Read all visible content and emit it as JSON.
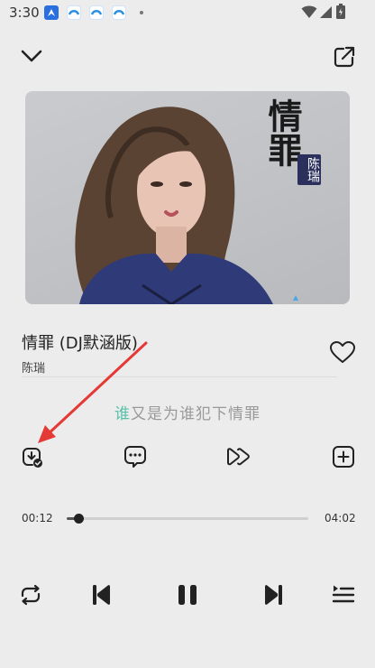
{
  "status_bar": {
    "time": "3:30"
  },
  "song": {
    "title": "情罪 (DJ默涵版)",
    "artist": "陈瑞",
    "cover_title": "情罪",
    "cover_artist": "陈瑞"
  },
  "lyrics": {
    "highlighted": "谁",
    "rest": "又是为谁犯下情罪"
  },
  "player": {
    "elapsed": "00:12",
    "duration": "04:02",
    "progress": 0.05
  },
  "colors": {
    "background": "#ececec",
    "lyric_highlight": "#58c0a8",
    "annotation_arrow": "#e53935"
  },
  "icons": {
    "collapse": "chevron-down-icon",
    "share": "share-external-icon",
    "like": "heart-outline-icon",
    "download": "download-done-icon",
    "comments": "comment-icon",
    "speed": "fast-forward-icon",
    "add_to_playlist": "add-square-icon",
    "repeat": "repeat-icon",
    "previous": "skip-previous-icon",
    "pause": "pause-icon",
    "next": "skip-next-icon",
    "queue": "playlist-icon"
  }
}
